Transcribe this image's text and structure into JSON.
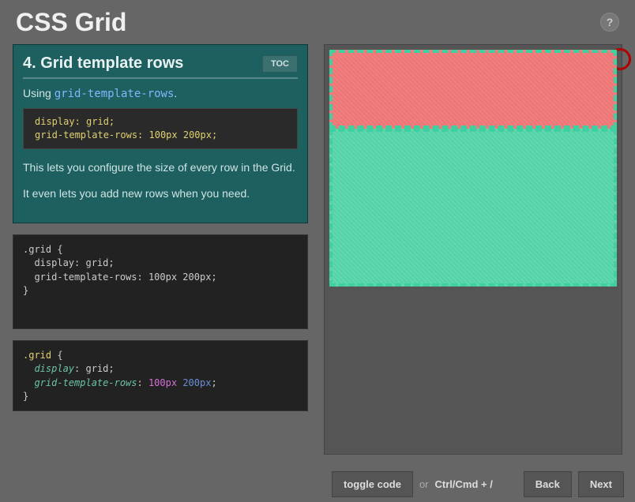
{
  "header": {
    "title": "CSS Grid",
    "help": "?"
  },
  "lesson": {
    "title": "4. Grid template rows",
    "toc_label": "TOC",
    "intro_prefix": "Using ",
    "intro_code": "grid-template-rows",
    "intro_suffix": ".",
    "inner_code": "display: grid;\ngrid-template-rows: 100px 200px;",
    "text1": "This lets you configure the size of every row in the Grid.",
    "text2": "It even lets you add new rows when you need."
  },
  "code1": ".grid {\n  display: grid;\n  grid-template-rows: 100px 200px;\n}",
  "code2": {
    "selector": ".grid",
    "open": " {",
    "line2_prop": "display",
    "line2_val": "grid",
    "line3_prop": "grid-template-rows",
    "line3_val1": "100px",
    "line3_val2": "200px",
    "close": "}"
  },
  "footer": {
    "toggle": "toggle code",
    "or": "or",
    "shortcut": "Ctrl/Cmd + /",
    "back": "Back",
    "next": "Next"
  }
}
